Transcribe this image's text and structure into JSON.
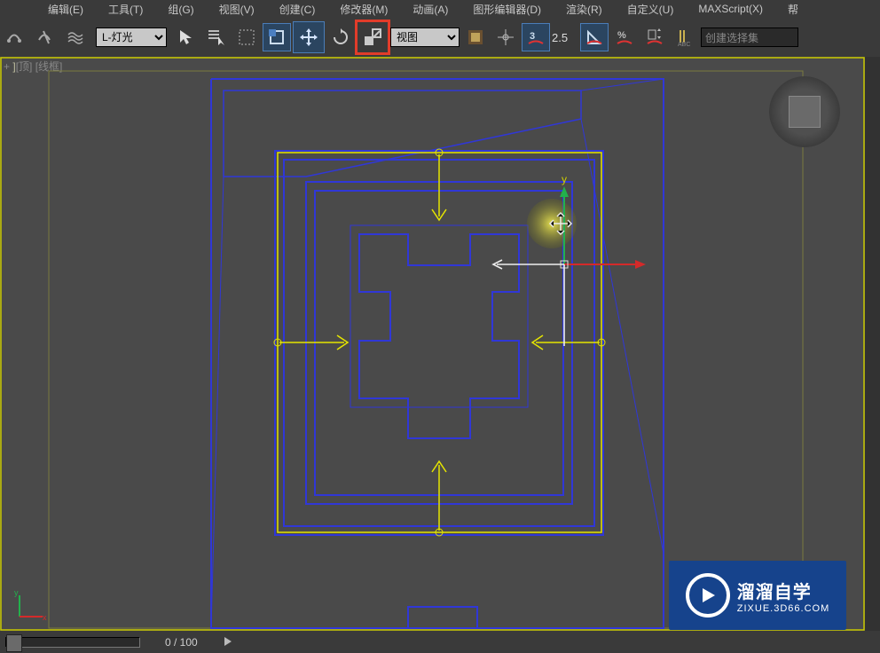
{
  "menubar": {
    "edit": "编辑(E)",
    "tools": "工具(T)",
    "group": "组(G)",
    "view": "视图(V)",
    "create": "创建(C)",
    "modify": "修改器(M)",
    "anim": "动画(A)",
    "graph": "图形编辑器(D)",
    "render": "渲染(R)",
    "custom": "自定义(U)",
    "max": "MAXScript(X)",
    "help": "帮"
  },
  "toolbar": {
    "layer_selected": "L-灯光",
    "ref_coord": "视图",
    "spinner_value": "2.5",
    "named_sel": "创建选择集"
  },
  "viewport": {
    "label_prefix": "+",
    "label_view": "[顶]",
    "label_style": "[线框]",
    "gizmo_y": "y"
  },
  "statusbar": {
    "frame": "0 / 100"
  },
  "watermark": {
    "title": "溜溜自学",
    "url": "ZIXUE.3D66.COM"
  }
}
